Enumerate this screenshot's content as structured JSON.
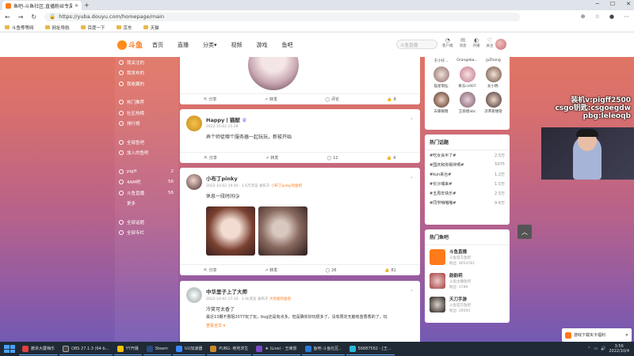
{
  "browser": {
    "tab_title": "鱼吧-斗鱼社区,直播粉丝专属交流平台",
    "url": "https://yuba.douyu.com/homepage/main",
    "bookmarks": [
      "斗鱼等等网",
      "网址导航",
      "百度一下",
      "京东",
      "天猫"
    ]
  },
  "site": {
    "logo_text": "斗鱼",
    "nav": [
      "首页",
      "直播",
      "分类▾",
      "视频",
      "游戏",
      "鱼吧"
    ],
    "search_placeholder": "斗鱼直播",
    "header_icons": [
      {
        "icon": "bell-icon",
        "label": "客户端"
      },
      {
        "icon": "chat-icon",
        "label": "消息"
      },
      {
        "icon": "lamp-icon",
        "label": "开播"
      },
      {
        "icon": "gift-icon",
        "label": "关注"
      }
    ]
  },
  "sidebar": {
    "group1": [
      {
        "icon": "doc-icon",
        "label": "我关注的"
      },
      {
        "icon": "send-icon",
        "label": "我发布的"
      },
      {
        "icon": "star-icon",
        "label": "我收藏的"
      }
    ],
    "group2": [
      {
        "icon": "flame-icon",
        "label": "热门推荐"
      },
      {
        "icon": "community-icon",
        "label": "社区热榜"
      },
      {
        "icon": "list-icon",
        "label": "排行榜"
      }
    ],
    "group3": [
      {
        "icon": "grid-icon",
        "label": "全部鱼吧"
      },
      {
        "icon": "plus-icon",
        "label": "加入的鱼吧"
      }
    ],
    "joined": [
      {
        "label": "pigff",
        "count": "2"
      },
      {
        "label": "4AM吧",
        "count": "56"
      },
      {
        "label": "斗鱼直播",
        "count": "56"
      }
    ],
    "more": "更多",
    "group4": [
      {
        "icon": "topic-icon",
        "label": "全部话题"
      },
      {
        "icon": "topic-icon",
        "label": "全部专栏"
      }
    ]
  },
  "feed": {
    "actions": {
      "share": "分享",
      "forward": "转发",
      "comment": "评论",
      "like": "8"
    },
    "post1": {
      "user": "Happy丨猫猷",
      "time": "2022-10-02 21:28",
      "text": "弄个师徒哪个服务器一起玩玩，新梭开始",
      "comments": "12",
      "likes": "4"
    },
    "post2": {
      "user": "小布丁pinky",
      "time": "2022-10-02 19:40 · 1.6万浏览",
      "via": "发布于",
      "tag": "小布丁pinky的鱼吧",
      "text": "休息一段时间😘",
      "comments": "26",
      "likes": "81"
    },
    "post3": {
      "user": "中华里子上了大师",
      "time": "2022-10-02 17:26 · 1.4k浏览",
      "via": "发布于",
      "tag": "大师爱的鱼吧",
      "text1": "冷笑可太香了",
      "text2": "最近13期不惠阻2077玩了玩，bug还是有点多，但是确实好玩很多了，没有限定无脑有苗香香的了，玩",
      "more": "查看全文 ▾"
    }
  },
  "right": {
    "top_users": [
      {
        "name": "于小仔..."
      },
      {
        "name": "Orangeba..."
      },
      {
        "name": "JyZhang"
      }
    ],
    "recommend": [
      [
        {
          "name": "猫星萌仙"
        },
        {
          "name": "果冻cc007"
        },
        {
          "name": "女小明-"
        }
      ],
      [
        {
          "name": "去暖暖糖"
        },
        {
          "name": "王丽想abc"
        },
        {
          "name": "凉茶斯维管"
        }
      ]
    ],
    "hot_topics_title": "热门话题",
    "hot_topics": [
      {
        "t": "#吃女会半了#",
        "n": "2.5万"
      },
      {
        "t": "#国庆和你相伴啊#",
        "n": "5075"
      },
      {
        "t": "#kun来台#",
        "n": "1.2万"
      },
      {
        "t": "#长沙瑞来#",
        "n": "1.5万"
      },
      {
        "t": "#五周年快乐#",
        "n": "2.5万"
      },
      {
        "t": "#同学咱嗷嗷#",
        "n": "9.6万"
      }
    ],
    "hot_bars_title": "热门鱼吧",
    "hot_bars": [
      {
        "name": "斗鱼直播",
        "sub": "斗鱼官方鱼吧",
        "fans": "粉丝: 8054781"
      },
      {
        "name": "韵韵玥",
        "sub": "斗鱼主播鱼吧",
        "fans": "粉丝: 5789"
      },
      {
        "name": "天刀手游",
        "sub": "斗鱼官方鱼吧",
        "fans": "粉丝: 29595"
      }
    ]
  },
  "overlay": {
    "line1": "装机v:pigff2500",
    "line2": "csgo钥匙:csgoegdw",
    "line3": "pbg:leleoqb"
  },
  "promo": "游戏下载实卡福利",
  "taskbar": {
    "items": [
      "撤资大厦嗨乐",
      "OBS 27.1.3 (64-b...",
      "YY开播",
      "Steam",
      "UU加速器",
      "PUBG: 绝地求生",
      "★ (Live) - 王峰景",
      "鱼吧-斗鱼社区..",
      "56887562 - [王..."
    ],
    "time": "3:56",
    "date": "2022/10/4"
  },
  "colors": {
    "accent": "#ff7a1a",
    "taskbar": "#1f2a36"
  }
}
